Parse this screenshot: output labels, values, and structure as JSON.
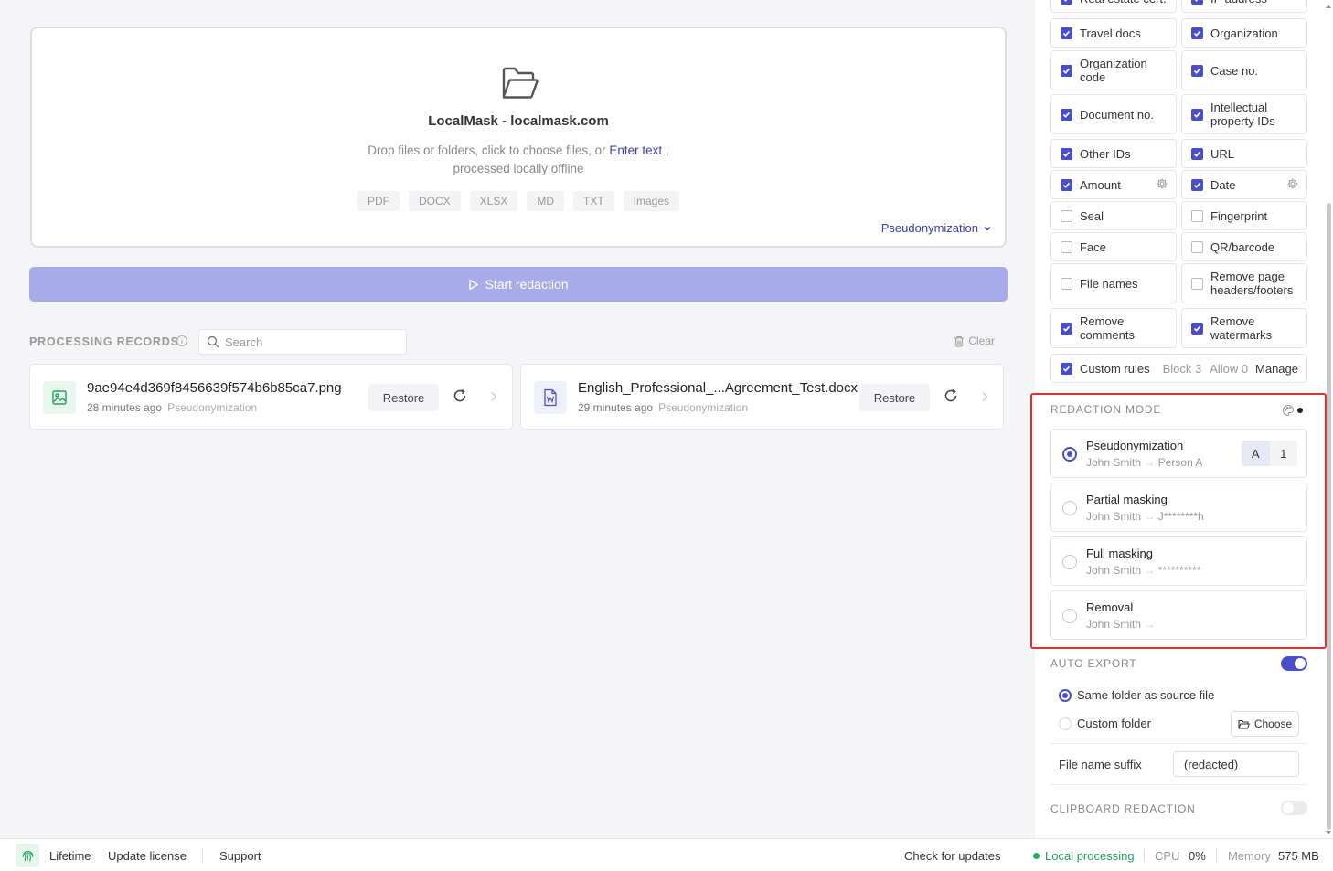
{
  "dropzone": {
    "title": "LocalMask - localmask.com",
    "desc_prefix": "Drop files or folders, click to choose files, or",
    "desc_link": "Enter text",
    "desc_comma": ",",
    "desc_line2": "processed locally offline",
    "formats": [
      "PDF",
      "DOCX",
      "XLSX",
      "MD",
      "TXT",
      "Images"
    ],
    "mode": "Pseudonymization"
  },
  "start_button": "Start redaction",
  "records": {
    "title": "PROCESSING RECORDS",
    "search_placeholder": "Search",
    "clear": "Clear",
    "items": [
      {
        "name": "9ae94e4d369f8456639f574b6b85ca7.png",
        "time": "28 minutes ago",
        "mode": "Pseudonymization",
        "restore": "Restore",
        "icon": "image-file-icon"
      },
      {
        "name": "English_Professional_...Agreement_Test.docx",
        "time": "29 minutes ago",
        "mode": "Pseudonymization",
        "restore": "Restore",
        "icon": "word-file-icon"
      }
    ]
  },
  "options": [
    {
      "label": "Real estate cert.",
      "checked": true
    },
    {
      "label": "IP address",
      "checked": true
    },
    {
      "label": "Travel docs",
      "checked": true
    },
    {
      "label": "Organization",
      "checked": true
    },
    {
      "label": "Organization code",
      "checked": true
    },
    {
      "label": "Case no.",
      "checked": true
    },
    {
      "label": "Document no.",
      "checked": true
    },
    {
      "label": "Intellectual property IDs",
      "checked": true
    },
    {
      "label": "Other IDs",
      "checked": true
    },
    {
      "label": "URL",
      "checked": true
    },
    {
      "label": "Amount",
      "checked": true,
      "gear": true
    },
    {
      "label": "Date",
      "checked": true,
      "gear": true
    },
    {
      "label": "Seal",
      "checked": false
    },
    {
      "label": "Fingerprint",
      "checked": false
    },
    {
      "label": "Face",
      "checked": false
    },
    {
      "label": "QR/barcode",
      "checked": false
    },
    {
      "label": "File names",
      "checked": false
    },
    {
      "label": "Remove page headers/footers",
      "checked": false
    },
    {
      "label": "Remove comments",
      "checked": true
    },
    {
      "label": "Remove watermarks",
      "checked": true
    }
  ],
  "custom_rules": {
    "label": "Custom rules",
    "block": "Block 3",
    "allow": "Allow 0",
    "manage": "Manage",
    "checked": true
  },
  "redaction_mode": {
    "title": "REDACTION MODE",
    "modes": [
      {
        "name": "Pseudonymization",
        "from": "John Smith",
        "arrow": "→",
        "to": "Person A",
        "selected": true,
        "seg": [
          "A",
          "1"
        ]
      },
      {
        "name": "Partial masking",
        "from": "John Smith",
        "arrow": "→",
        "to": "J********h",
        "selected": false
      },
      {
        "name": "Full masking",
        "from": "John Smith",
        "arrow": "→",
        "to": "**********",
        "selected": false
      },
      {
        "name": "Removal",
        "from": "John Smith",
        "arrow": "→",
        "to": "",
        "selected": false
      }
    ]
  },
  "auto_export": {
    "title": "AUTO EXPORT",
    "enabled": true,
    "same_folder": "Same folder as source file",
    "custom_folder": "Custom folder",
    "choose": "Choose",
    "suffix_label": "File name suffix",
    "suffix_value": "(redacted)"
  },
  "clipboard": {
    "title": "CLIPBOARD REDACTION",
    "enabled": false
  },
  "status": {
    "lifetime": "Lifetime",
    "update_license": "Update license",
    "support": "Support",
    "check_updates": "Check for updates",
    "local_processing": "Local processing",
    "cpu_label": "CPU",
    "cpu_value": "0%",
    "mem_label": "Memory",
    "mem_value": "575 MB"
  },
  "colors": {
    "accent": "#4a4fc8",
    "start_button": "#a7abe8",
    "highlight_border": "#e03131",
    "green": "#22b35e"
  }
}
